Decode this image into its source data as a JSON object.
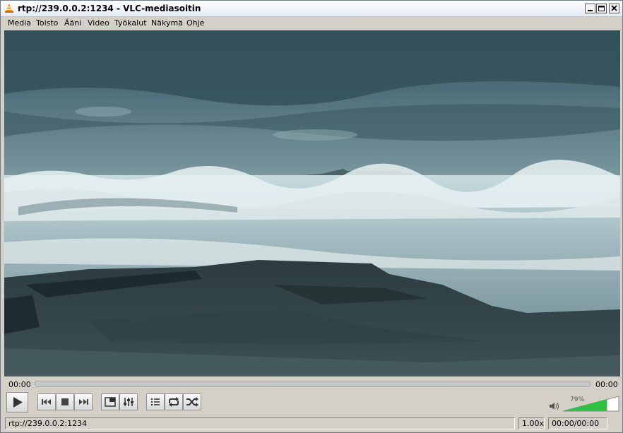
{
  "window": {
    "title": "rtp://239.0.0.2:1234 - VLC-mediasoitin",
    "app_icon": "vlc-cone-icon",
    "controls": [
      "minimize-icon",
      "maximize-icon",
      "close-icon"
    ]
  },
  "menu": {
    "items": [
      "Media",
      "Toisto",
      "Ääni",
      "Video",
      "Työkalut",
      "Näkymä",
      "Ohje"
    ]
  },
  "video": {
    "scene": "stormy sea with waves breaking on rocky shore, distant island under cloudy sky"
  },
  "seekbar": {
    "elapsed": "00:00",
    "total": "00:00",
    "progress": 0
  },
  "controls": {
    "buttons": [
      "play-icon",
      "previous-icon",
      "stop-icon",
      "next-icon",
      "fullscreen-icon",
      "extended-settings-icon",
      "playlist-icon",
      "loop-icon",
      "shuffle-icon"
    ],
    "volume_icon": "speaker-icon",
    "volume_percent": "79%",
    "volume_level": 0.79,
    "volume_color": "#2ec040"
  },
  "status": {
    "source": "rtp://239.0.0.2:1234",
    "speed": "1.00x",
    "time": "00:00/00:00"
  }
}
